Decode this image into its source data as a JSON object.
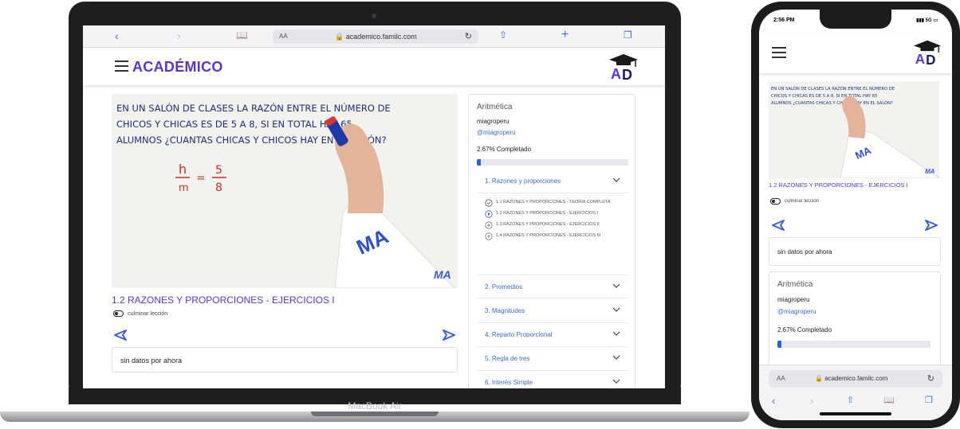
{
  "colors": {
    "accent": "#5b34d6",
    "link": "#3a6bd6",
    "progress": "#2a62d8"
  },
  "laptop": {
    "brand": "MacBook Air",
    "browser": {
      "back_icon": "chevron-left-icon",
      "forward_icon": "chevron-right-icon",
      "aa": "AA",
      "url": "academico.familc.com",
      "reload_icon": "reload-icon"
    },
    "site": {
      "title": "ACADÉMICO",
      "logo_text": "AD"
    },
    "lesson": {
      "title": "1.2 RAZONES Y PROPORCIONES - EJERCICIOS I",
      "complete_label": "culminar lección",
      "nodata": "sin datos por ahora"
    },
    "video": {
      "line1": "EN UN SALÓN DE CLASES LA RAZÓN ENTRE EL NÚMERO DE",
      "line2": "CHICOS Y CHICAS ES DE 5 A 8, SI EN TOTAL HAY 65",
      "line3": "ALUMNOS ¿CUANTAS CHICAS Y CHICOS HAY EN EL SALÓN?",
      "num_h": "h",
      "den_m": "m",
      "num_5": "5",
      "den_8": "8",
      "eq": "=",
      "watermark": "MA"
    },
    "panel": {
      "course": "Aritmética",
      "author": "miagroperu",
      "handle": "@miagroperu",
      "progress_label": "2.67% Completado",
      "progress_fraction": 0.0267,
      "modules": [
        {
          "label": "1. Razones y proporciones"
        },
        {
          "label": "2. Promedios"
        },
        {
          "label": "3. Magnitudes"
        },
        {
          "label": "4. Reparto Proporcional"
        },
        {
          "label": "5. Regla de tres"
        },
        {
          "label": "6. Interés Simple"
        }
      ],
      "lessons": [
        {
          "label": "1.1 RAZONES Y PROPORCIONES - TEORÍA COMPLETA",
          "icon": "check-circle-icon"
        },
        {
          "label": "1.2 RAZONES Y PROPORCIONES - EJERCICIOS I",
          "icon": "play-circle-icon"
        },
        {
          "label": "1.3 RAZONES Y PROPORCIONES - EJERCICIOS II",
          "icon": "plus-circle-icon"
        },
        {
          "label": "1.4 RAZONES Y PROPORCIONES - EJERCICIOS III",
          "icon": "plus-circle-icon"
        }
      ]
    }
  },
  "phone": {
    "time": "2:56 PM",
    "signal": "5G",
    "lesson_title": "1.2 RAZONES Y PROPORCIONES - EJERCICIOS I",
    "complete_label": "culminar lección",
    "nodata": "sin datos por ahora",
    "course": "Aritmética",
    "author": "miagroperu",
    "handle": "@miagroperu",
    "progress_label": "2.67% Completado",
    "progress_fraction": 0.0267,
    "aa": "AA",
    "url": "academico.familc.com"
  }
}
